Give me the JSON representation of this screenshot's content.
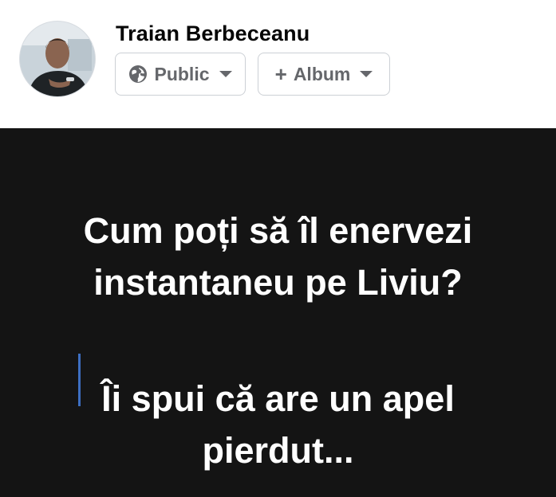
{
  "author": {
    "name": "Traian Berbeceanu"
  },
  "privacy": {
    "label": "Public",
    "icon": "globe-icon"
  },
  "album": {
    "label": "Album",
    "icon": "plus-icon"
  },
  "post": {
    "background": "#141414",
    "text_color": "#ffffff",
    "question_lines": [
      "Cum poți să îl enervezi",
      "instantaneu pe Liviu?"
    ],
    "answer_lines": [
      "Îi spui că are un apel",
      "pierdut..."
    ]
  },
  "colors": {
    "muted": "#65676b",
    "border": "#ccd0d5",
    "cursor": "#3d6fc2"
  }
}
